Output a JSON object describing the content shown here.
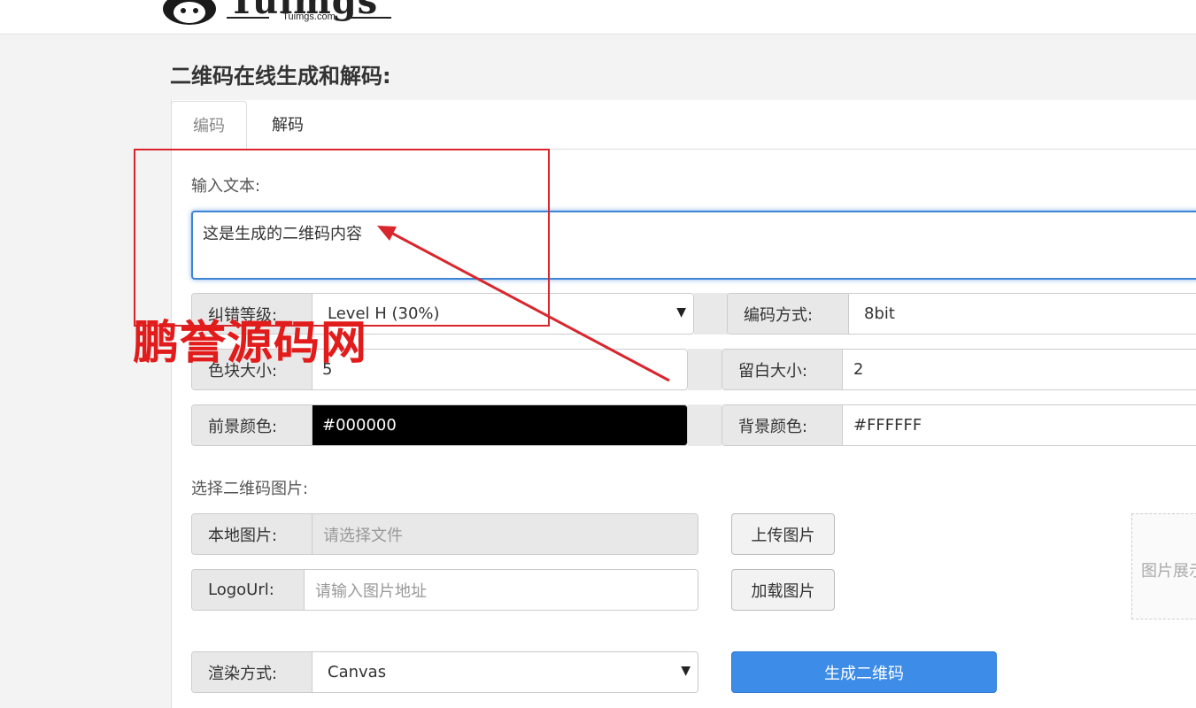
{
  "header": {
    "logo_word": "Tuimgs",
    "logo_sub": "Tuimgs.com"
  },
  "page_title": "二维码在线生成和解码:",
  "tabs": [
    {
      "label": "编码",
      "active": true
    },
    {
      "label": "解码",
      "active": false
    }
  ],
  "encode": {
    "input_label": "输入文本:",
    "input_value": "这是生成的二维码内容",
    "error_level_label": "纠错等级:",
    "error_level_value": "Level H (30%)",
    "encoding_label": "编码方式:",
    "encoding_value": "8bit",
    "block_size_label": "色块大小:",
    "block_size_value": "5",
    "margin_label": "留白大小:",
    "margin_value": "2",
    "fg_label": "前景颜色:",
    "fg_value": "#000000",
    "bg_label": "背景颜色:",
    "bg_value": "#FFFFFF",
    "select_image_label": "选择二维码图片:",
    "local_image_label": "本地图片:",
    "local_image_placeholder": "请选择文件",
    "upload_button": "上传图片",
    "logo_url_label": "LogoUrl:",
    "logo_url_placeholder": "请输入图片地址",
    "load_button": "加载图片",
    "preview_text": "图片展示",
    "render_label": "渲染方式:",
    "render_value": "Canvas",
    "generate_button": "生成二维码"
  },
  "watermark": "鹏誉源码网",
  "colors": {
    "accent": "#3c8ce8",
    "annotation": "#d9262c"
  }
}
